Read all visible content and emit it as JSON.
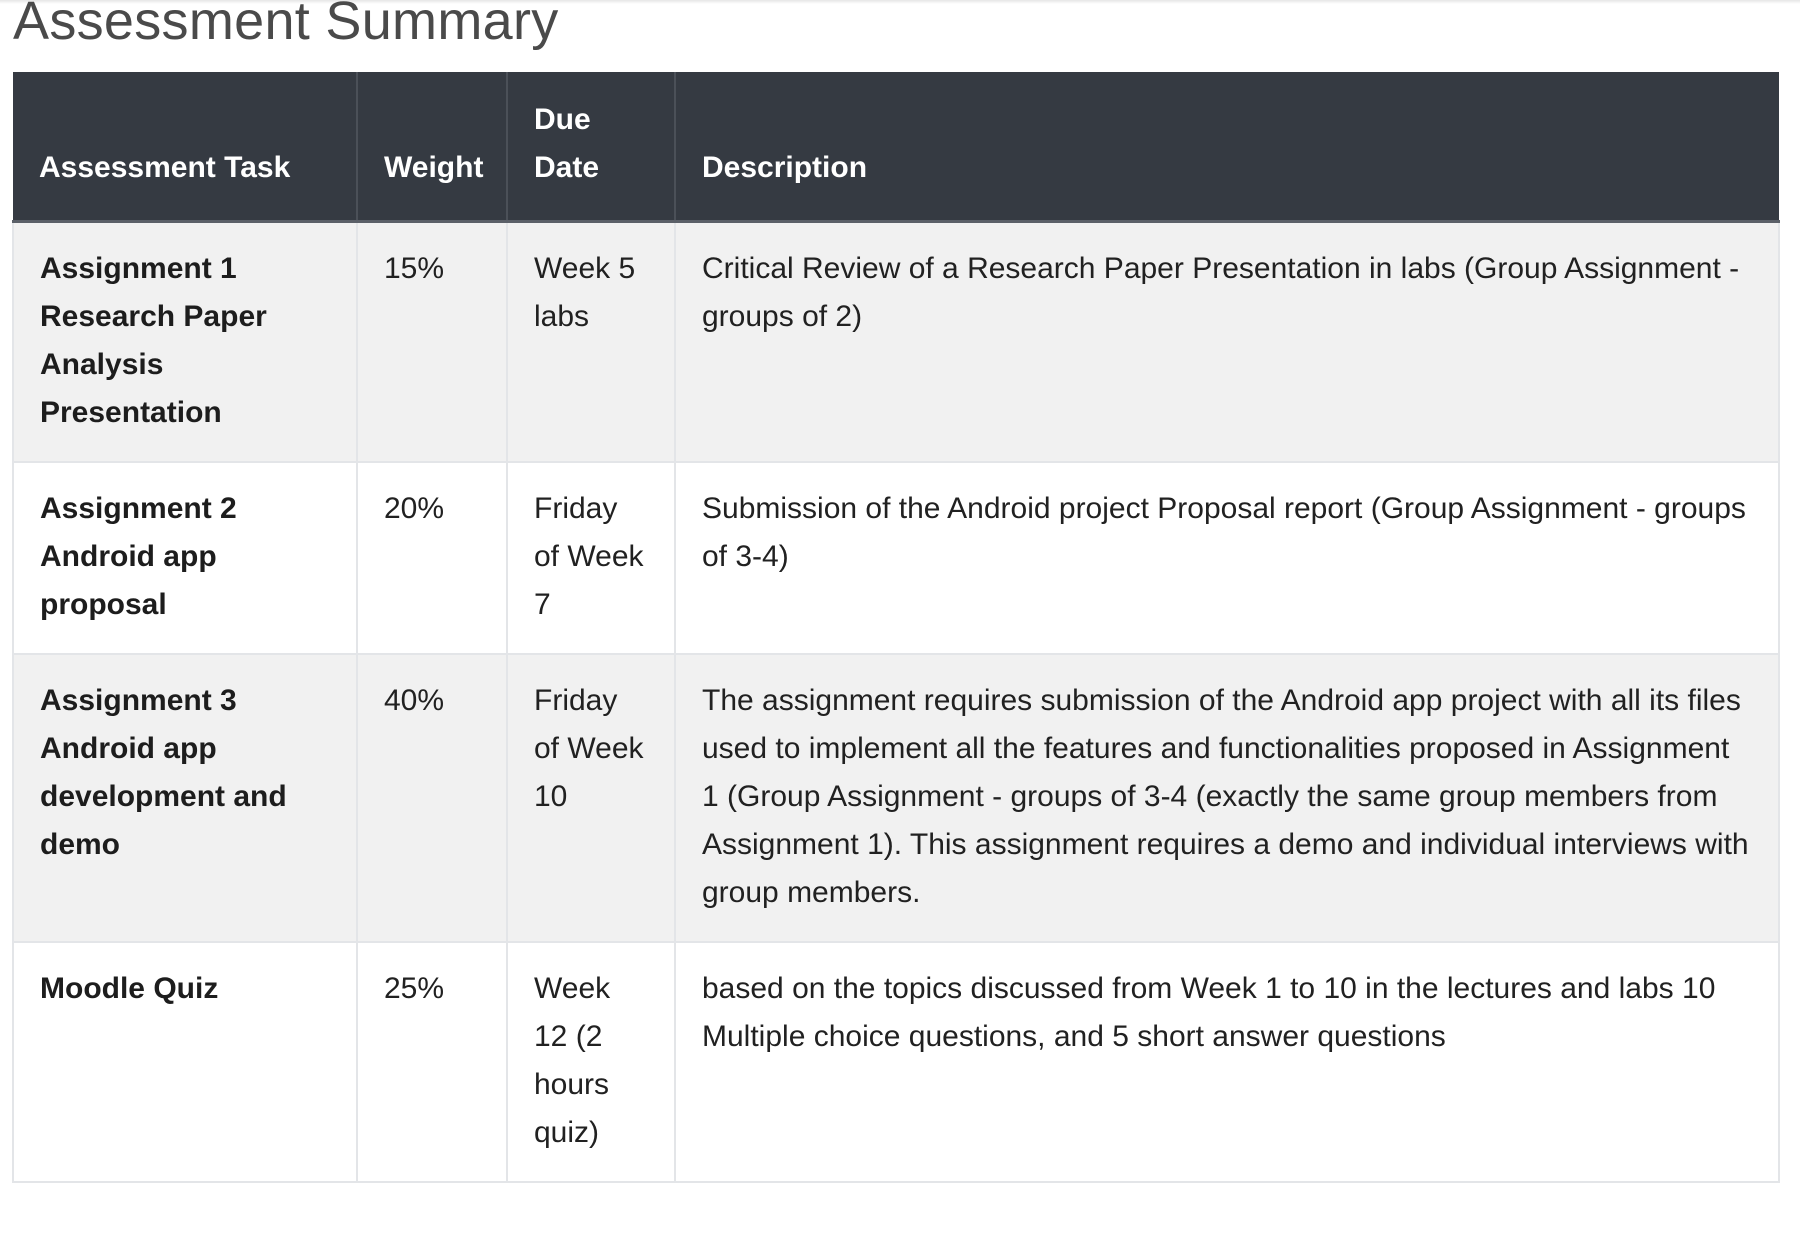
{
  "page": {
    "title": "Assessment Summary"
  },
  "table": {
    "headers": {
      "task": "Assessment Task",
      "weight": "Weight",
      "due_date": "Due Date",
      "description": "Description"
    },
    "rows": [
      {
        "task_title": "Assignment 1",
        "task_subtitle": "Research Paper Analysis Presentation",
        "weight": "15%",
        "due_date": "Week 5 labs",
        "description": "Critical Review of a Research Paper Presentation in labs  (Group Assignment - groups of 2)"
      },
      {
        "task_title": "Assignment 2",
        "task_subtitle": "Android app proposal",
        "weight": "20%",
        "due_date": "Friday of Week 7",
        "description": "Submission of the Android project Proposal report (Group Assignment - groups of 3-4)"
      },
      {
        "task_title": "Assignment 3",
        "task_subtitle": "Android app development and demo",
        "weight": "40%",
        "due_date": "Friday of Week 10",
        "description": "The assignment requires submission of the Android app project with all its files used to implement all the features and functionalities proposed in Assignment 1 (Group Assignment - groups of 3-4 (exactly the same group members from Assignment 1). This assignment requires a demo and individual interviews with group members."
      },
      {
        "task_title": "Moodle Quiz",
        "task_subtitle": "",
        "weight": "25%",
        "due_date": "Week 12 (2 hours quiz)",
        "description": "based on the topics discussed from Week 1 to 10 in the lectures and labs 10 Multiple choice questions, and 5 short answer questions"
      }
    ]
  }
}
